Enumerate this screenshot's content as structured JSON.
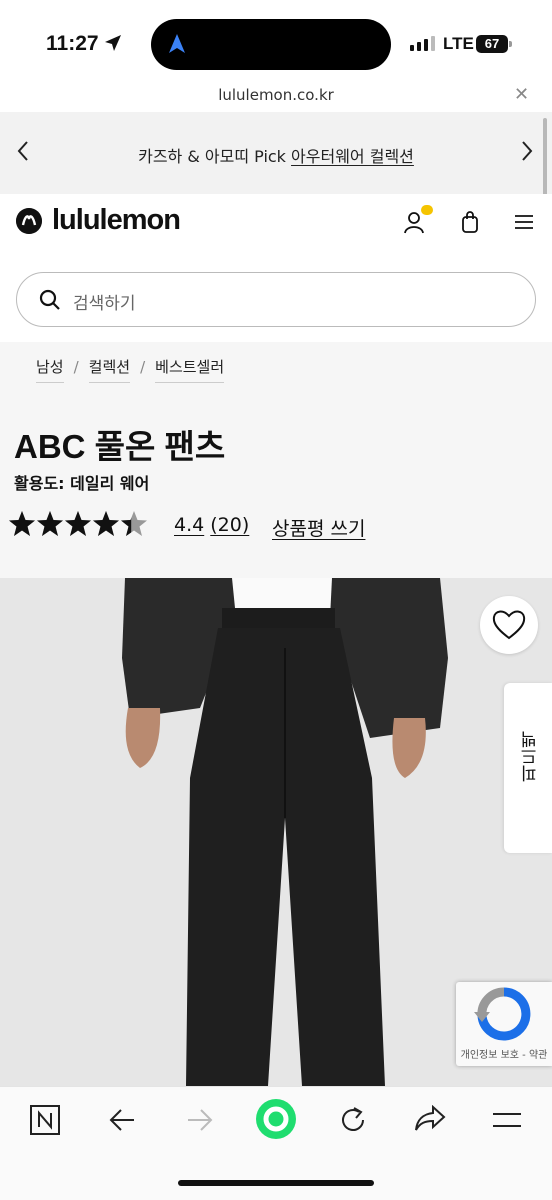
{
  "status_bar": {
    "time": "11:27",
    "network": "LTE",
    "battery": "67"
  },
  "browser": {
    "url": "lululemon.co.kr"
  },
  "promo": {
    "prefix": "카즈하 & 아모띠 Pick ",
    "link": "아우터웨어 컬렉션"
  },
  "header": {
    "logo": "lululemon",
    "icons": [
      "user-icon",
      "shopping-bag-icon",
      "menu-icon"
    ]
  },
  "search": {
    "placeholder": "검색하기"
  },
  "breadcrumbs": [
    {
      "label": "남성"
    },
    {
      "label": "컬렉션"
    },
    {
      "label": "베스트셀러"
    }
  ],
  "product": {
    "title": "ABC 풀온 팬츠",
    "usage": "활용도: 데일리 웨어",
    "rating": 4.4,
    "rating_text": "4.4",
    "review_count": "(20)",
    "write_review": "상품평 쓰기"
  },
  "side_tab": {
    "label": "피드백"
  },
  "recaptcha": {
    "text": "개인정보 보호 - 약관"
  },
  "toolbar": {
    "buttons": [
      "naver-icon",
      "back-arrow-icon",
      "forward-arrow-icon",
      "green-dot-icon",
      "reload-icon",
      "share-icon",
      "menu-icon"
    ]
  },
  "colors": {
    "brand": "#111111",
    "background": "#f6f6f6",
    "accent_green": "#1fdd6f",
    "badge_yellow": "#f5c400"
  }
}
